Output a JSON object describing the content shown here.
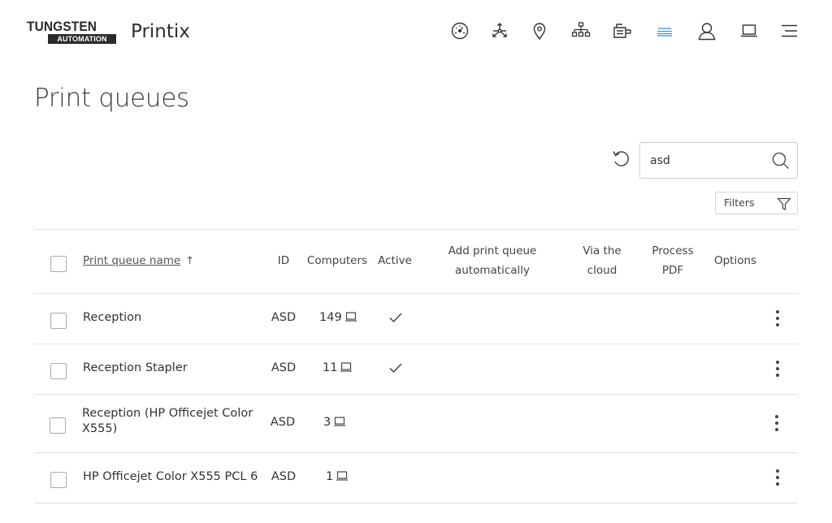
{
  "brand": {
    "logo_top": "TUNGSTEN",
    "logo_bottom": "AUTOMATION",
    "product": "Printix"
  },
  "nav_icons": [
    "dashboard-icon",
    "workflow-icon",
    "location-icon",
    "network-icon",
    "printer-icon",
    "print-queue-icon",
    "user-icon",
    "computer-icon",
    "menu-icon"
  ],
  "active_nav": "print-queue-icon",
  "colors": {
    "accent": "#3a92d2",
    "text": "#333333",
    "border": "#e1e1e1"
  },
  "page": {
    "title": "Print queues"
  },
  "search": {
    "value": "asd",
    "placeholder": ""
  },
  "filters": {
    "label": "Filters"
  },
  "table": {
    "headers": {
      "name": "Print queue name",
      "sort_arrow": "↑",
      "id": "ID",
      "computers": "Computers",
      "active": "Active",
      "add_auto_1": "Add print queue",
      "add_auto_2": "automatically",
      "via_cloud_1": "Via the",
      "via_cloud_2": "cloud",
      "process_pdf_1": "Process",
      "process_pdf_2": "PDF",
      "options": "Options"
    },
    "rows": [
      {
        "name": "Reception",
        "name_line2": "",
        "id": "ASD",
        "computers": "149",
        "active": true
      },
      {
        "name": "Reception Stapler",
        "name_line2": "",
        "id": "ASD",
        "computers": "11",
        "active": true
      },
      {
        "name": "Reception (HP Officejet Color",
        "name_line2": "X555)",
        "id": "ASD",
        "computers": "3",
        "active": false
      },
      {
        "name": "HP Officejet Color X555 PCL 6",
        "name_line2": "",
        "id": "ASD",
        "computers": "1",
        "active": false
      }
    ]
  }
}
